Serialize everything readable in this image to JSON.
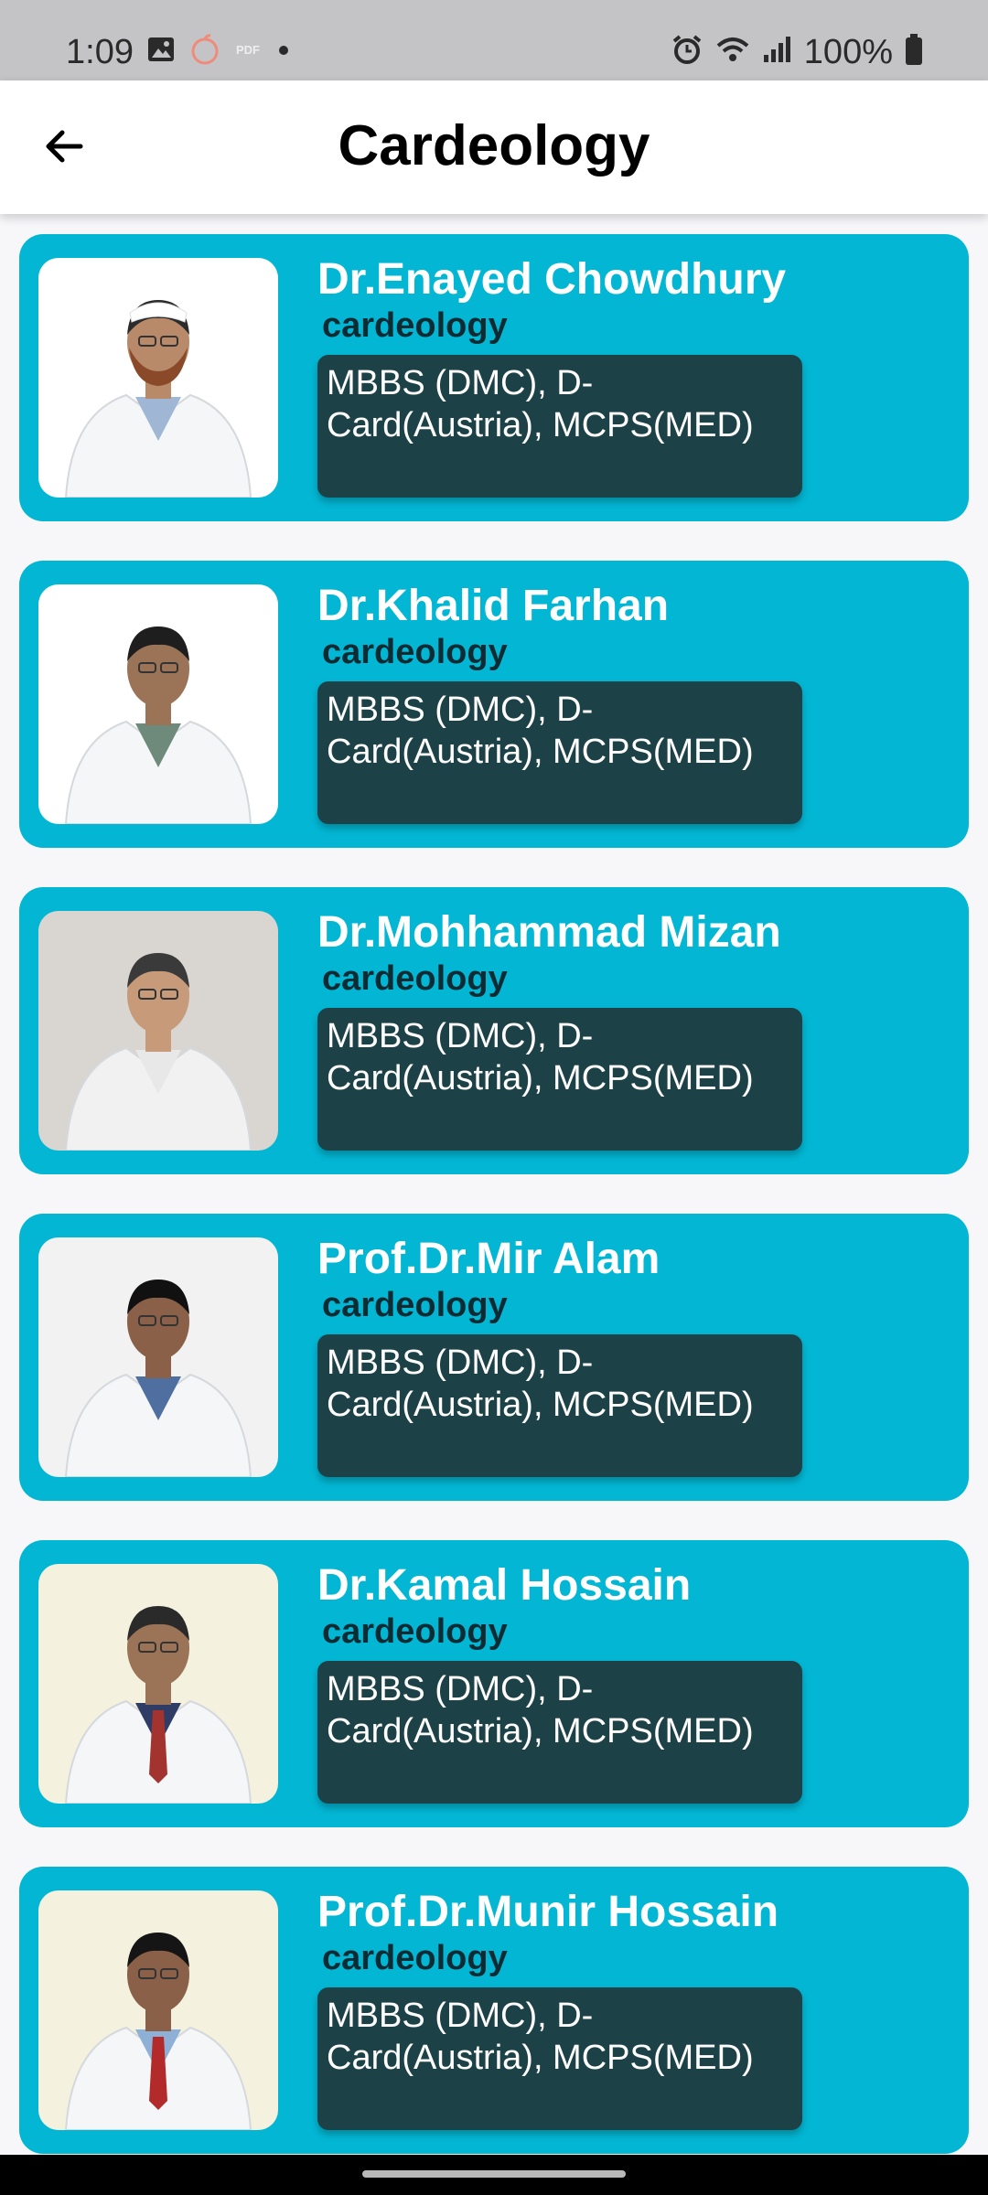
{
  "status_bar": {
    "time": "1:09",
    "battery": "100%",
    "left_icons": [
      "gallery-icon",
      "app-icon",
      "pdf-icon",
      "dot-icon"
    ],
    "right_icons": [
      "alarm-icon",
      "wifi-icon",
      "signal-icon",
      "battery-icon"
    ]
  },
  "header": {
    "title": "Cardeology",
    "back_icon": "arrow-left-icon"
  },
  "doctors": [
    {
      "name": "Dr.Enayed Chowdhury",
      "department": "cardeology",
      "qualification": "MBBS (DMC), D-Card(Austria), MCPS(MED)",
      "photo_bg": "#ffffff"
    },
    {
      "name": "Dr.Khalid Farhan",
      "department": "cardeology",
      "qualification": "MBBS (DMC), D-Card(Austria), MCPS(MED)",
      "photo_bg": "#ffffff"
    },
    {
      "name": "Dr.Mohhammad Mizan",
      "department": "cardeology",
      "qualification": "MBBS (DMC), D-Card(Austria), MCPS(MED)",
      "photo_bg": "#d9d6d2"
    },
    {
      "name": "Prof.Dr.Mir Alam",
      "department": "cardeology",
      "qualification": "MBBS (DMC), D-Card(Austria), MCPS(MED)",
      "photo_bg": "#f2f2f2"
    },
    {
      "name": "Dr.Kamal Hossain",
      "department": "cardeology",
      "qualification": "MBBS (DMC), D-Card(Austria), MCPS(MED)",
      "photo_bg": "#f4f2df"
    },
    {
      "name": "Prof.Dr.Munir Hossain",
      "department": "cardeology",
      "qualification": "MBBS (DMC), D-Card(Austria), MCPS(MED)",
      "photo_bg": "#f4f2df"
    }
  ],
  "colors": {
    "card": "#03b7d4",
    "qualification_box": "#1c4248",
    "department_text": "#0d2b33"
  }
}
